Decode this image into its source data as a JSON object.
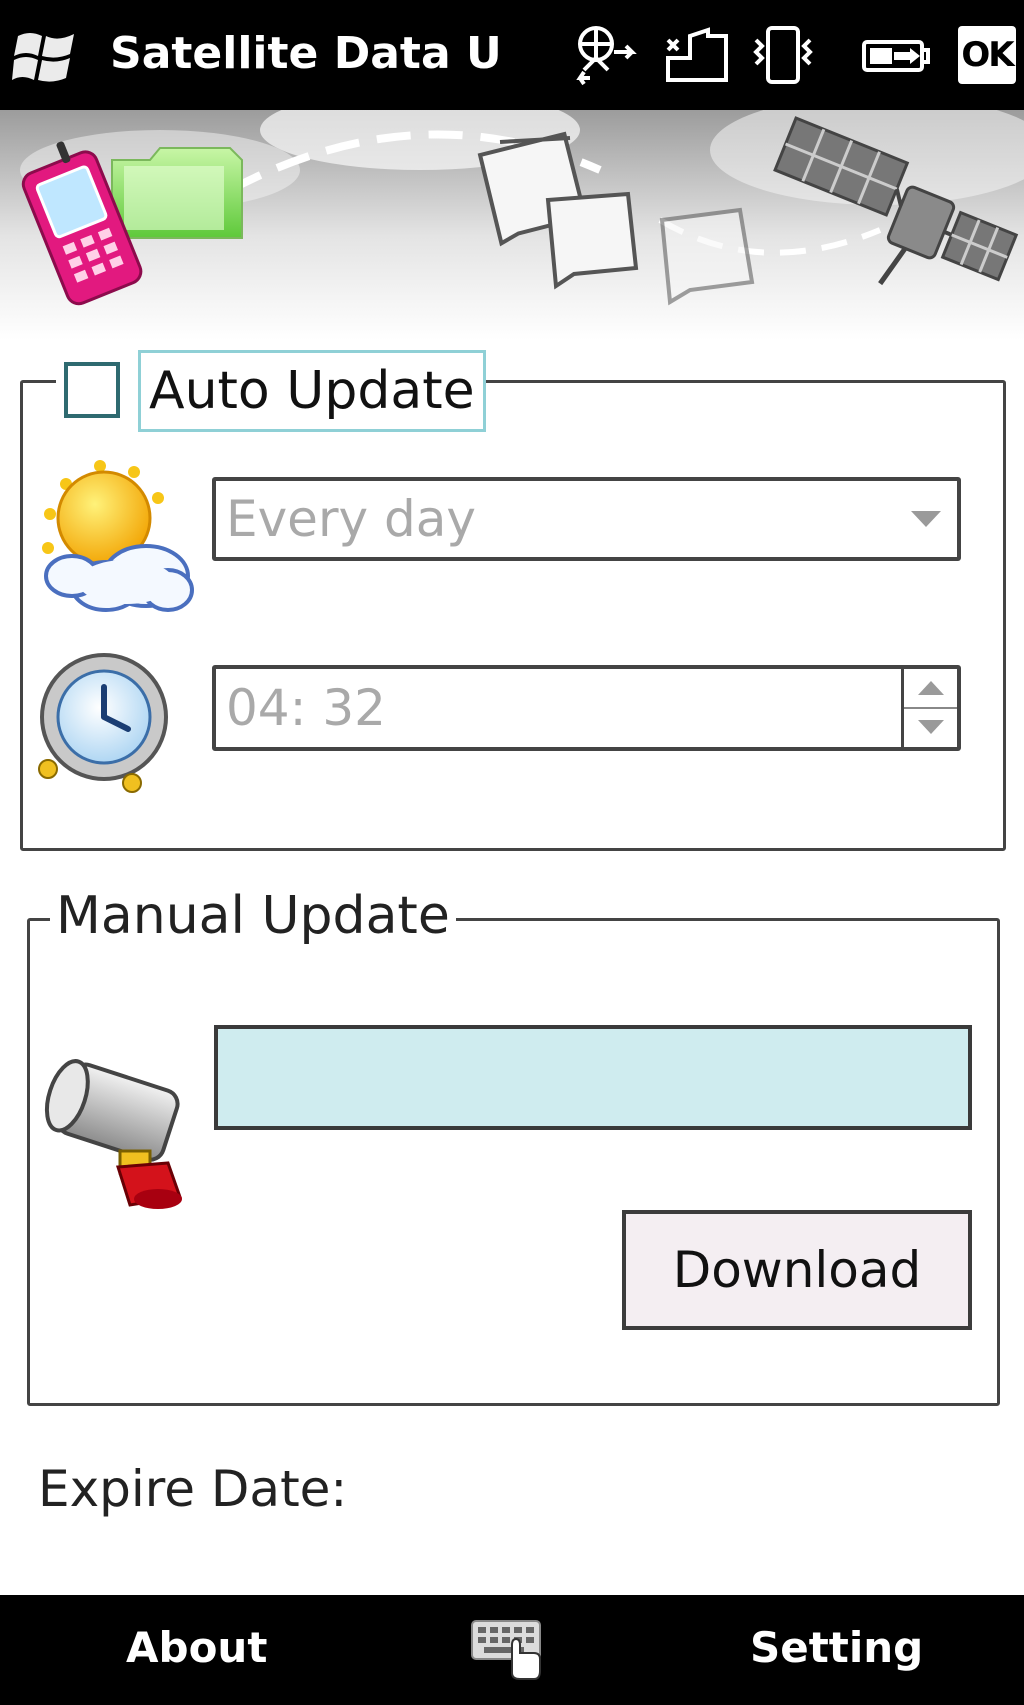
{
  "titlebar": {
    "title": "Satellite Data U",
    "icons": [
      "windows-start-icon",
      "connectivity-icon",
      "no-signal-icon",
      "vibrate-icon",
      "battery-icon"
    ],
    "ok_label": "OK"
  },
  "banner": {
    "icons": [
      "pink-phone-icon",
      "green-folder-icon",
      "document-icon",
      "satellite-icon"
    ]
  },
  "auto_update": {
    "checkbox_label": "Auto Update",
    "checked": false,
    "frequency": {
      "value": "Every day",
      "icon": "sun-cloud-icon"
    },
    "time": {
      "value": "04: 32",
      "icon": "alarm-clock-icon"
    }
  },
  "manual_update": {
    "label": "Manual Update",
    "icon": "mallet-icon",
    "progress_color": "#cfecef",
    "download_label": "Download"
  },
  "expire": {
    "label": "Expire Date:"
  },
  "menubar": {
    "left_label": "About",
    "center_icon": "keyboard-icon",
    "right_label": "Setting"
  }
}
